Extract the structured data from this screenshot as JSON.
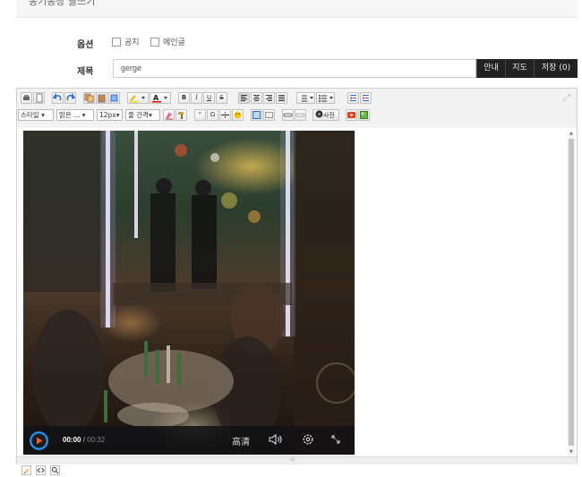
{
  "header": {
    "title": "동기동창 글쓰기"
  },
  "options": {
    "label": "옵션",
    "items": [
      {
        "label": "공지",
        "checked": false
      },
      {
        "label": "메인글",
        "checked": false
      }
    ]
  },
  "subject": {
    "label": "제목",
    "value": "gerge"
  },
  "actions": {
    "guide": "안내",
    "map": "지도",
    "save": "저장 (0)"
  },
  "toolbar": {
    "style": "스타일",
    "font": "맑은 ...",
    "size": "12px",
    "line_height": "줄 간격",
    "photo": "사진",
    "bold": "B",
    "italic": "I",
    "underline": "U",
    "strike": "S",
    "quote": "“",
    "omega": "Ω"
  },
  "video": {
    "current_time": "00:00",
    "duration": "00:32",
    "quality": "高清",
    "time_sep": " / "
  },
  "colors": {
    "accent": "#2d88e8",
    "save_bg": "#222222",
    "toolbar_bg": "#f2f2f2"
  },
  "modes": [
    "edit-icon",
    "html-icon",
    "preview-icon"
  ]
}
